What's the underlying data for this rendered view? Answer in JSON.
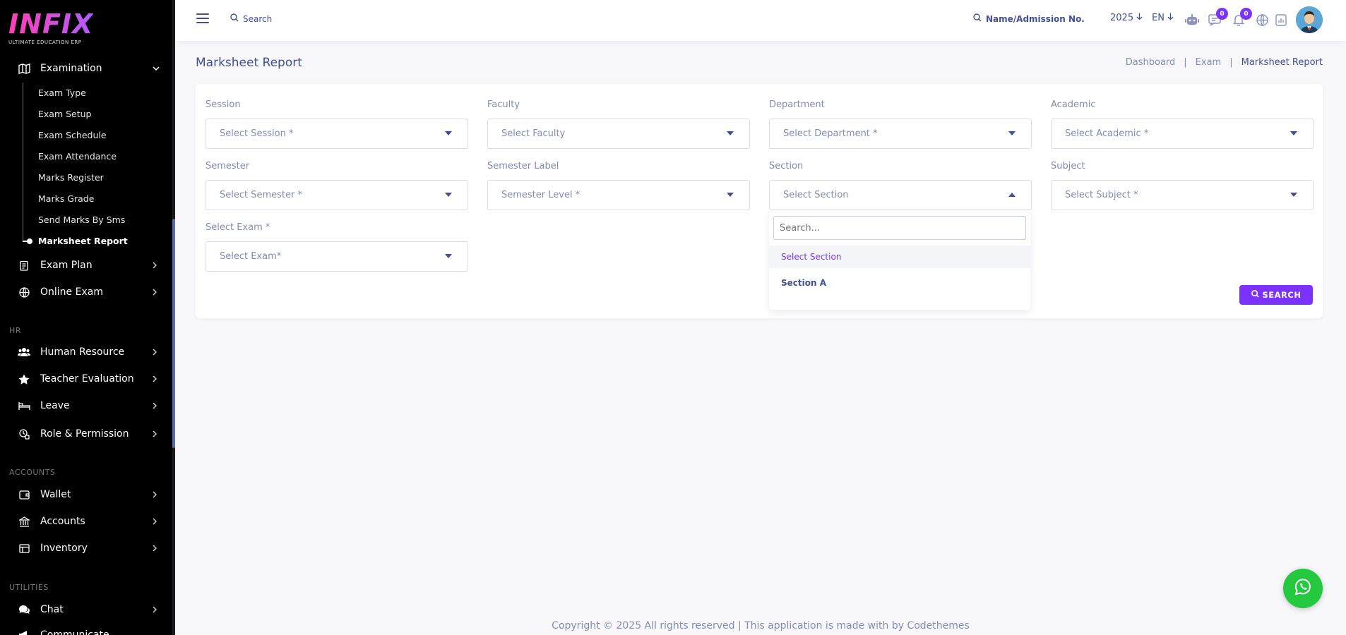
{
  "brand": {
    "logo_text": "INFIX",
    "logo_sub": "ULTIMATE EDUCATION ERP"
  },
  "sidebar": {
    "examination": {
      "label": "Examination",
      "icon": "map-icon"
    },
    "sub_items": [
      "Exam Type",
      "Exam Setup",
      "Exam Schedule",
      "Exam Attendance",
      "Marks Register",
      "Marks Grade",
      "Send Marks By Sms",
      "Marksheet Report"
    ],
    "items_exam": [
      {
        "label": "Exam Plan",
        "icon": "clipboard-icon"
      },
      {
        "label": "Online Exam",
        "icon": "globe-icon"
      }
    ],
    "section_hr": "HR",
    "items_hr": [
      {
        "label": "Human Resource",
        "icon": "users-icon"
      },
      {
        "label": "Teacher Evaluation",
        "icon": "star-icon"
      },
      {
        "label": "Leave",
        "icon": "bed-icon"
      },
      {
        "label": "Role & Permission",
        "icon": "permission-icon"
      }
    ],
    "section_accounts": "ACCOUNTS",
    "items_accounts": [
      {
        "label": "Wallet",
        "icon": "wallet-icon"
      },
      {
        "label": "Accounts",
        "icon": "bank-icon"
      },
      {
        "label": "Inventory",
        "icon": "inventory-icon"
      }
    ],
    "section_utilities": "UTILITIES",
    "items_utilities": [
      {
        "label": "Chat",
        "icon": "chat-icon"
      },
      {
        "label": "Communicate",
        "icon": "megaphone-icon"
      }
    ]
  },
  "topbar": {
    "search_label": "Search",
    "student_search": "Name/Admission No.",
    "year": "2025",
    "lang": "EN",
    "chat_badge": "0",
    "notif_badge": "0"
  },
  "page": {
    "title": "Marksheet Report",
    "breadcrumb": [
      "Dashboard",
      "Exam",
      "Marksheet Report"
    ]
  },
  "form": {
    "session": {
      "label": "Session",
      "value": "Select Session *"
    },
    "faculty": {
      "label": "Faculty",
      "value": "Select Faculty"
    },
    "department": {
      "label": "Department",
      "value": "Select Department *"
    },
    "academic": {
      "label": "Academic",
      "value": "Select Academic *"
    },
    "semester": {
      "label": "Semester",
      "value": "Select Semester *"
    },
    "semester_label": {
      "label": "Semester Label",
      "value": "Semester Level *"
    },
    "section": {
      "label": "Section",
      "value": "Select Section"
    },
    "subject": {
      "label": "Subject",
      "value": "Select Subject *"
    },
    "exam": {
      "label": "Select Exam *",
      "value": "Select Exam*"
    },
    "section_dropdown": {
      "search_placeholder": "Search...",
      "options": [
        "Select Section",
        "Section A"
      ]
    },
    "search_button": "SEARCH"
  },
  "footer": {
    "text": "Copyright © 2025 All rights reserved | This application is made with by Codethemes"
  },
  "colors": {
    "accent": "#7c32ff",
    "primary_text": "#415094",
    "whatsapp": "#25c940"
  }
}
